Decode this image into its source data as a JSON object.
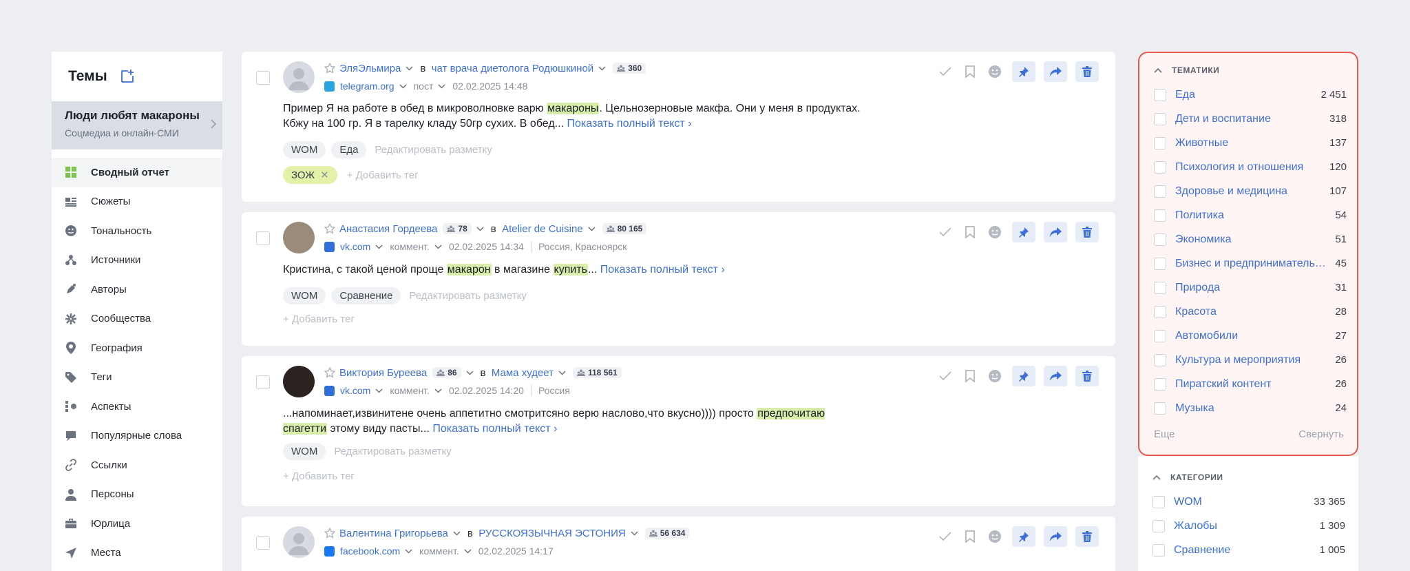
{
  "sidebar": {
    "title": "Темы",
    "theme": {
      "name": "Люди любят макароны",
      "sub": "Соцмедиа и онлайн-СМИ"
    },
    "items": [
      {
        "label": "Сводный отчет",
        "icon": "grid-icon",
        "active": true
      },
      {
        "label": "Сюжеты",
        "icon": "stories-icon"
      },
      {
        "label": "Тональность",
        "icon": "smile-icon"
      },
      {
        "label": "Источники",
        "icon": "sources-icon"
      },
      {
        "label": "Авторы",
        "icon": "authors-icon"
      },
      {
        "label": "Сообщества",
        "icon": "communities-icon"
      },
      {
        "label": "География",
        "icon": "location-pin-icon"
      },
      {
        "label": "Теги",
        "icon": "tag-icon"
      },
      {
        "label": "Аспекты",
        "icon": "aspects-icon"
      },
      {
        "label": "Популярные слова",
        "icon": "speech-bubble-icon"
      },
      {
        "label": "Ссылки",
        "icon": "link-icon"
      },
      {
        "label": "Персоны",
        "icon": "person-icon"
      },
      {
        "label": "Юрлица",
        "icon": "briefcase-icon"
      },
      {
        "label": "Места",
        "icon": "navigation-arrow-icon"
      }
    ]
  },
  "posts": [
    {
      "author": "ЭляЭльмира",
      "in": "в",
      "community": "чат врача диетолога Родюшкиной",
      "community_followers": "360",
      "network": "telegram.org",
      "network_color": "#2aa4e0",
      "type": "пост",
      "date": "02.02.2025 14:48",
      "text_parts": [
        "Пример Я на работе в обед в микроволновке варю ",
        "макароны",
        ". Цельнозерновые макфа. Они у меня в продуктах. Кбжу на 100 гр. Я в тарелку кладу 50гр сухих. В обед... "
      ],
      "more": "Показать полный текст ›",
      "tags": [
        "WOM",
        "Еда"
      ],
      "edit": "Редактировать разметку",
      "user_tag": "ЗОЖ",
      "add_tag": "+ Добавить тег"
    },
    {
      "author": "Анастасия Гордеева",
      "author_followers": "78",
      "in": "в",
      "community": "Atelier de Cuisine",
      "community_followers": "80 165",
      "network": "vk.com",
      "network_color": "#2f6fd6",
      "type": "коммент.",
      "date": "02.02.2025 14:34",
      "location": "Россия, Красноярск",
      "text_parts": [
        "Кристина, с такой ценой проще ",
        "макарон",
        " в магазине ",
        "купить",
        "... "
      ],
      "more": "Показать полный текст ›",
      "tags": [
        "WOM",
        "Сравнение"
      ],
      "edit": "Редактировать разметку",
      "add_tag": "+ Добавить тег"
    },
    {
      "author": "Виктория Буреева",
      "author_followers": "86",
      "in": "в",
      "community": "Мама худеет",
      "community_followers": "118 561",
      "network": "vk.com",
      "network_color": "#2f6fd6",
      "type": "коммент.",
      "date": "02.02.2025 14:20",
      "location": "Россия",
      "text_parts": [
        "...напоминает,извинитене очень аппетитно смотритсяно верю насловo,что вкусно)))) просто ",
        "предпочитаю спагетти",
        " этому виду пасты... "
      ],
      "more": "Показать полный текст ›",
      "tags": [
        "WOM"
      ],
      "edit": "Редактировать разметку",
      "add_tag": "+ Добавить тег"
    },
    {
      "author": "Валентина Григорьева",
      "in": "в",
      "community": "РУССКОЯЗЫЧНАЯ ЭСТОНИЯ",
      "community_followers": "56 634",
      "network": "facebook.com",
      "network_color": "#1877f2",
      "type": "коммент.",
      "date": "02.02.2025 14:17"
    }
  ],
  "topics": {
    "title": "ТЕМАТИКИ",
    "items": [
      {
        "label": "Еда",
        "count": "2 451"
      },
      {
        "label": "Дети и воспитание",
        "count": "318"
      },
      {
        "label": "Животные",
        "count": "137"
      },
      {
        "label": "Психология и отношения",
        "count": "120"
      },
      {
        "label": "Здоровье и медицина",
        "count": "107"
      },
      {
        "label": "Политика",
        "count": "54"
      },
      {
        "label": "Экономика",
        "count": "51"
      },
      {
        "label": "Бизнес и предпринимательство",
        "count": "45"
      },
      {
        "label": "Природа",
        "count": "31"
      },
      {
        "label": "Красота",
        "count": "28"
      },
      {
        "label": "Автомобили",
        "count": "27"
      },
      {
        "label": "Культура и мероприятия",
        "count": "26"
      },
      {
        "label": "Пиратский контент",
        "count": "26"
      },
      {
        "label": "Музыка",
        "count": "24"
      }
    ],
    "more": "Еще",
    "collapse": "Свернуть"
  },
  "categories": {
    "title": "КАТЕГОРИИ",
    "items": [
      {
        "label": "WOM",
        "count": "33 365"
      },
      {
        "label": "Жалобы",
        "count": "1 309"
      },
      {
        "label": "Сравнение",
        "count": "1 005"
      }
    ]
  }
}
